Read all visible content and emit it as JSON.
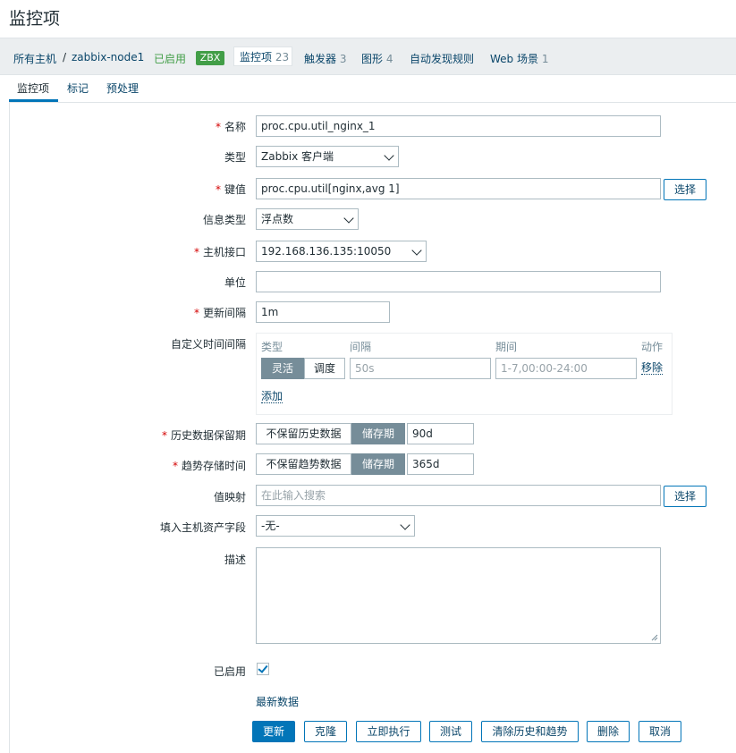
{
  "page": {
    "title": "监控项"
  },
  "breadcrumb": {
    "all_hosts": "所有主机",
    "separator": "/",
    "host": "zabbix-node1",
    "status": "已启用",
    "zbx": "ZBX",
    "items_label": "监控项",
    "items_count": "23",
    "triggers_label": "触发器",
    "triggers_count": "3",
    "graphs_label": "图形",
    "graphs_count": "4",
    "discovery_label": "自动发现规则",
    "web_label": "Web 场景",
    "web_count": "1"
  },
  "tabs": [
    {
      "label": "监控项",
      "active": true
    },
    {
      "label": "标记",
      "active": false
    },
    {
      "label": "预处理",
      "active": false
    }
  ],
  "form": {
    "required_mark": "*",
    "name": {
      "label": "名称",
      "value": "proc.cpu.util_nginx_1"
    },
    "type": {
      "label": "类型",
      "value": "Zabbix 客户端"
    },
    "key": {
      "label": "键值",
      "value": "proc.cpu.util[nginx,avg 1]",
      "button": "选择"
    },
    "info_type": {
      "label": "信息类型",
      "value": "浮点数"
    },
    "interface": {
      "label": "主机接口",
      "value": "192.168.136.135:10050"
    },
    "units": {
      "label": "单位",
      "value": ""
    },
    "update_interval": {
      "label": "更新间隔",
      "value": "1m"
    },
    "custom_intervals": {
      "label": "自定义时间间隔",
      "headers": {
        "type": "类型",
        "interval": "间隔",
        "period": "期间",
        "action": "动作"
      },
      "row": {
        "flexible": "灵活",
        "scheduling": "调度",
        "interval_placeholder": "50s",
        "period_placeholder": "1-7,00:00-24:00",
        "remove": "移除"
      },
      "add": "添加"
    },
    "history": {
      "label": "历史数据保留期",
      "no_keep": "不保留历史数据",
      "storage": "储存期",
      "value": "90d"
    },
    "trends": {
      "label": "趋势存储时间",
      "no_keep": "不保留趋势数据",
      "storage": "储存期",
      "value": "365d"
    },
    "value_map": {
      "label": "值映射",
      "placeholder": "在此输入搜索",
      "button": "选择"
    },
    "inventory": {
      "label": "填入主机资产字段",
      "value": "-无-"
    },
    "description": {
      "label": "描述",
      "value": ""
    },
    "enabled": {
      "label": "已启用",
      "checked": true
    },
    "latest_data": "最新数据"
  },
  "actions": {
    "update": "更新",
    "clone": "克隆",
    "execute": "立即执行",
    "test": "测试",
    "clear": "清除历史和趋势",
    "delete": "删除",
    "cancel": "取消"
  },
  "colors": {
    "accent": "#0275b8",
    "enabled_green": "#429e47",
    "required_red": "#d40000"
  }
}
